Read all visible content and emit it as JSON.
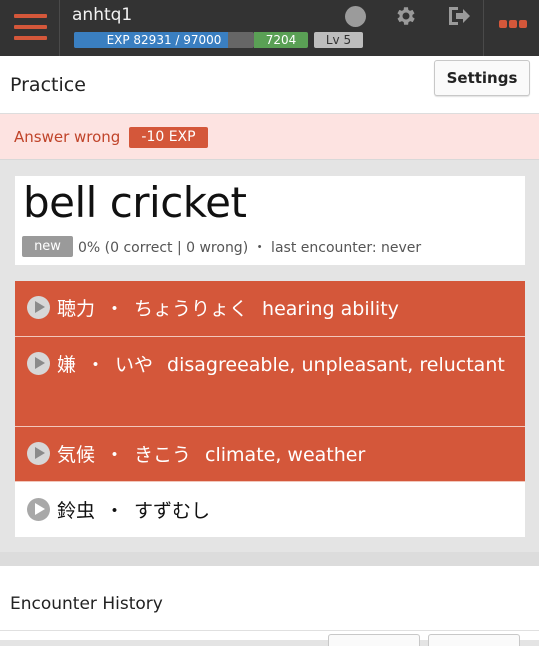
{
  "topbar": {
    "username": "anhtq1",
    "exp_text": "EXP 82931 / 97000",
    "exp_fraction": 0.855,
    "gold": "7204",
    "level": "Lv 5",
    "icons": [
      "menu-icon",
      "status-dot-icon",
      "gear-icon",
      "logout-icon",
      "more-icon"
    ],
    "accent_color": "#d4573a"
  },
  "header": {
    "title": "Practice",
    "settings_label": "Settings"
  },
  "alert": {
    "text": "Answer wrong",
    "exp_change": "-10 EXP"
  },
  "word": {
    "title": "bell cricket",
    "badge": "new",
    "stats": "0% (0 correct | 0 wrong) ・ last encounter: never"
  },
  "answers": [
    {
      "kanji": "聴力",
      "dot": "・",
      "kana": "ちょうりょく",
      "meaning": "hearing ability",
      "state": "wrong"
    },
    {
      "kanji": "嫌",
      "dot": "・",
      "kana": "いや",
      "meaning": "disagreeable, unpleasant, reluctant",
      "state": "wrong"
    },
    {
      "kanji": "気候",
      "dot": "・",
      "kana": "きこう",
      "meaning": "climate, weather",
      "state": "wrong"
    },
    {
      "kanji": "鈴虫",
      "dot": "・",
      "kana": "すずむし",
      "meaning": "",
      "state": "correct"
    }
  ],
  "history": {
    "title": "Encounter History"
  }
}
